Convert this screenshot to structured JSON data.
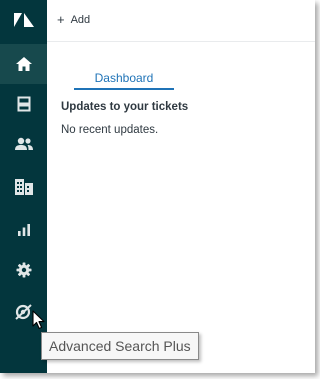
{
  "header": {
    "add_label": "Add"
  },
  "tabs": [
    {
      "label": "Dashboard",
      "active": true
    }
  ],
  "main": {
    "heading": "Updates to your tickets",
    "empty_text": "No recent updates."
  },
  "sidebar": {
    "items": [
      {
        "icon": "zendesk-logo-icon"
      },
      {
        "icon": "home-icon",
        "active": true
      },
      {
        "icon": "views-icon"
      },
      {
        "icon": "customers-icon"
      },
      {
        "icon": "organizations-icon"
      },
      {
        "icon": "reporting-icon"
      },
      {
        "icon": "gear-icon"
      },
      {
        "icon": "advanced-search-icon"
      }
    ]
  },
  "tooltip": {
    "text": "Advanced Search Plus"
  },
  "colors": {
    "sidebar_bg": "#03363d",
    "sidebar_active_bg": "#17494d",
    "accent": "#1f73b7"
  }
}
